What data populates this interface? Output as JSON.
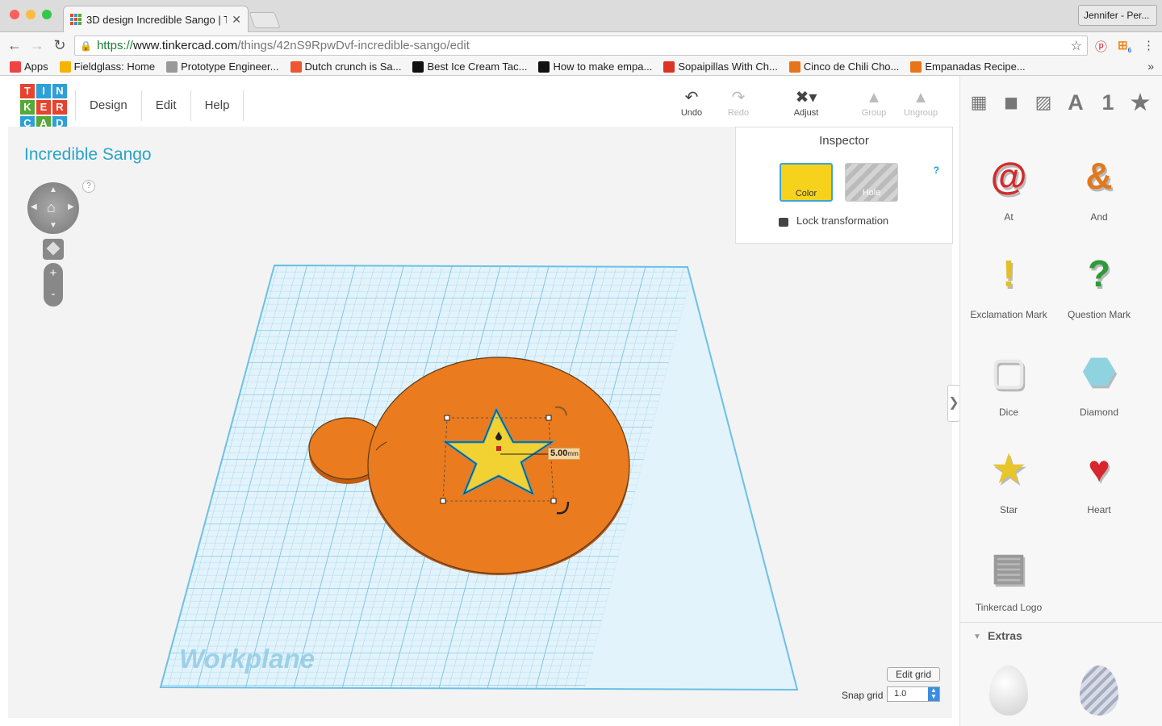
{
  "browser": {
    "tab_title": "3D design Incredible Sango | T",
    "profile_name": "Jennifer - Per...",
    "url_scheme": "https://",
    "url_host": "www.tinkercad.com",
    "url_path": "/things/42nS9RpwDvf-incredible-sango/edit",
    "bookmarks": [
      {
        "label": "Apps",
        "icon": "apps-grid-icon"
      },
      {
        "label": "Fieldglass: Home",
        "icon": "fieldglass-icon"
      },
      {
        "label": "Prototype Engineer...",
        "icon": "page-icon"
      },
      {
        "label": "Dutch crunch is Sa...",
        "icon": "red-star-icon"
      },
      {
        "label": "Best Ice Cream Tac...",
        "icon": "d-logo-icon"
      },
      {
        "label": "How to make empa...",
        "icon": "l-logo-icon"
      },
      {
        "label": "Sopaipillas With Ch...",
        "icon": "food-icon"
      },
      {
        "label": "Cinco de Chili Cho...",
        "icon": "orange-o-icon"
      },
      {
        "label": "Empanadas Recipe...",
        "icon": "orange-o-icon"
      }
    ],
    "ext_badge": "6"
  },
  "app": {
    "logo_letters": [
      "T",
      "I",
      "N",
      "K",
      "E",
      "R",
      "C",
      "A",
      "D"
    ],
    "menu": [
      "Design",
      "Edit",
      "Help"
    ],
    "tools": {
      "undo": "Undo",
      "redo": "Redo",
      "adjust": "Adjust",
      "group": "Group",
      "ungroup": "Ungroup"
    },
    "design_title": "Incredible Sango",
    "help_mark": "?"
  },
  "inspector": {
    "title": "Inspector",
    "color_label": "Color",
    "hole_label": "Hole",
    "help": "?",
    "lock_label": "Lock transformation",
    "selected_color": "#f7d21d"
  },
  "workplane": {
    "label": "Workplane",
    "dimension": "5.00",
    "dimension_unit": "mm",
    "edit_grid": "Edit grid",
    "snap_label": "Snap grid",
    "snap_value": "1.0"
  },
  "shapes_panel": {
    "category_tabs": [
      {
        "icon": "grid-icon",
        "glyph": "▦"
      },
      {
        "icon": "cube-icon",
        "glyph": "◼"
      },
      {
        "icon": "striped-cube-icon",
        "glyph": "▨"
      },
      {
        "icon": "letters-icon",
        "glyph": "A"
      },
      {
        "icon": "numbers-icon",
        "glyph": "1"
      },
      {
        "icon": "favorites-star-icon",
        "glyph": "★"
      }
    ],
    "shapes": [
      {
        "label": "At",
        "color": "#d42a2a",
        "glyph": "@"
      },
      {
        "label": "And",
        "color": "#e07a1f",
        "glyph": "&"
      },
      {
        "label": "Exclamation Mark",
        "color": "#e2c028",
        "glyph": "!"
      },
      {
        "label": "Question Mark",
        "color": "#2e9a3c",
        "glyph": "?"
      },
      {
        "label": "Dice",
        "color": "#e8e8e8",
        "glyph": "▢"
      },
      {
        "label": "Diamond",
        "color": "#8fd3e0",
        "glyph": "⬣"
      },
      {
        "label": "Star",
        "color": "#e8c52a",
        "glyph": "★"
      },
      {
        "label": "Heart",
        "color": "#d6262e",
        "glyph": "♥"
      },
      {
        "label": "Tinkercad Logo",
        "color": "#9a9a9a",
        "glyph": "▤"
      }
    ],
    "extras_label": "Extras"
  }
}
